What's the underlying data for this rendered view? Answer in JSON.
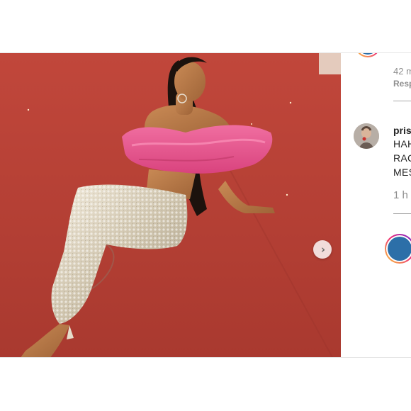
{
  "post": {
    "photo_alt": "",
    "next_icon": "chevron-right-icon"
  },
  "comments_panel": {
    "top_item": {
      "time": "42 m",
      "reply_label": "Resp"
    },
    "comment": {
      "username": "pris",
      "lines": [
        "HAH",
        "RAC",
        "MES"
      ],
      "time": "1 h"
    }
  },
  "colors": {
    "backdrop": "#b53f35",
    "avatar_ring_start": "#f9ce34",
    "avatar_ring_mid": "#ee2a7b",
    "avatar_ring_end": "#6228d7",
    "avatar_core": "#2c6fa8",
    "muted_text": "#8e8e8e",
    "text": "#262626"
  }
}
